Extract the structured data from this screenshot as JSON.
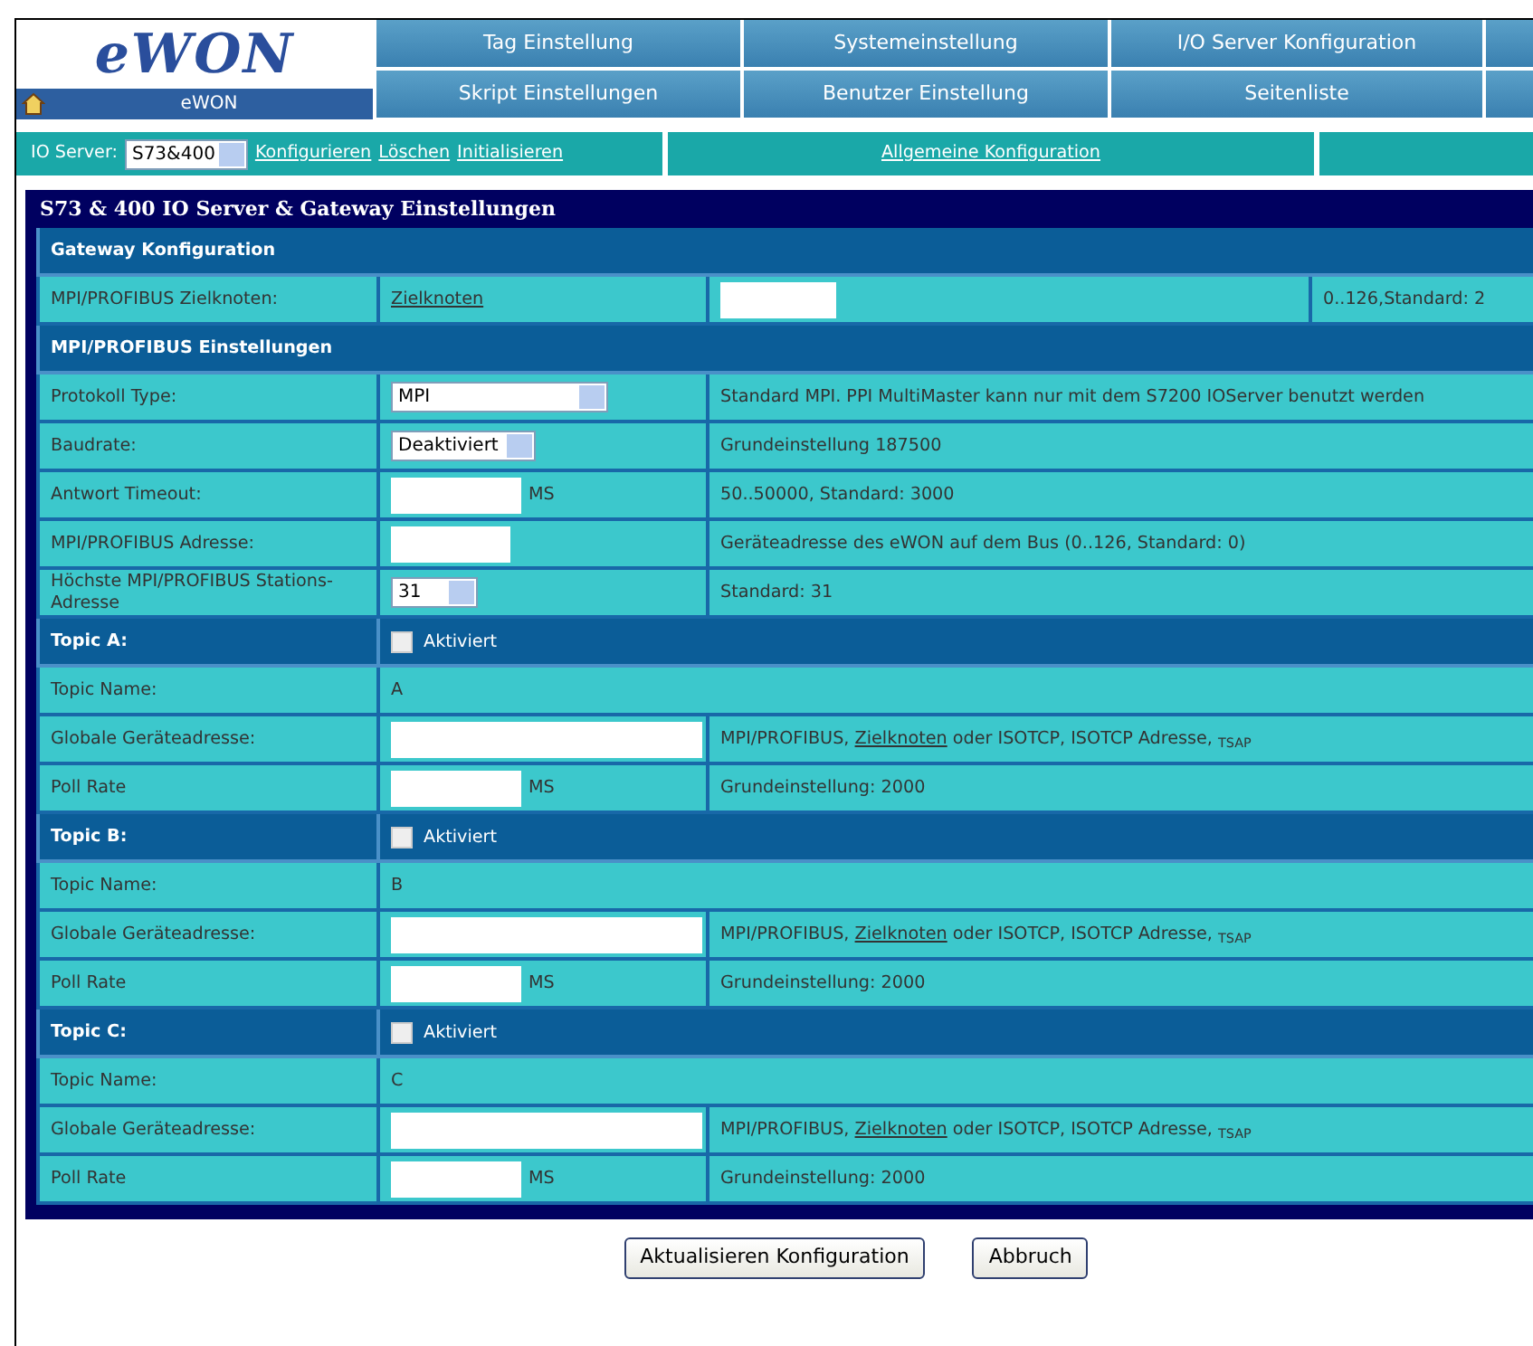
{
  "logo": {
    "text": "eWON",
    "caption": "eWON"
  },
  "nav": [
    {
      "label": "Tag Einstellung"
    },
    {
      "label": "Systemeinstellung"
    },
    {
      "label": "I/O Server Konfiguration"
    },
    {
      "label": "Skript Einstellungen"
    },
    {
      "label": "Benutzer Einstellung"
    },
    {
      "label": "Seitenliste"
    }
  ],
  "toolbar": {
    "label": "IO Server:",
    "server_select": "S73&400",
    "links": [
      "Konfigurieren",
      "Löschen",
      "Initialisieren"
    ],
    "general_link": "Allgemeine Konfiguration"
  },
  "panel": {
    "title": "S73 & 400 IO Server & Gateway Einstellungen",
    "sections": [
      {
        "title": "Gateway Konfiguration",
        "rows": [
          {
            "kind": "link_input",
            "label": "MPI/PROFIBUS Zielknoten:",
            "link": "Zielknoten",
            "hint": "0..126,Standard: 2"
          }
        ]
      },
      {
        "title": "MPI/PROFIBUS Einstellungen",
        "rows": [
          {
            "kind": "select",
            "label": "Protokoll Type:",
            "value": "MPI",
            "hint": "Standard MPI. PPI MultiMaster kann nur mit dem S7200 IOServer benutzt werden"
          },
          {
            "kind": "select",
            "label": "Baudrate:",
            "value": "Deaktiviert",
            "hint": "Grundeinstellung 187500"
          },
          {
            "kind": "input",
            "label": "Antwort Timeout:",
            "unit": "MS",
            "hint": "50..50000, Standard: 3000"
          },
          {
            "kind": "input",
            "label": "MPI/PROFIBUS Adresse:",
            "hint": "Geräteadresse des eWON auf dem Bus (0..126, Standard: 0)"
          },
          {
            "kind": "select",
            "label": "Höchste MPI/PROFIBUS Stations-Adresse",
            "value": "31",
            "hint": "Standard: 31"
          }
        ]
      },
      {
        "title": "Topic A:",
        "checkbox": {
          "label": "Aktiviert",
          "checked": false
        },
        "rows": [
          {
            "kind": "text",
            "label": "Topic Name:",
            "value": "A"
          },
          {
            "kind": "wide_input",
            "label": "Globale Geräteadresse:",
            "hint_parts": {
              "before": "MPI/PROFIBUS, ",
              "link": "Zielknoten",
              "after": " oder ISOTCP, ISOTCP Adresse, $_{TSAP}$"
            }
          },
          {
            "kind": "input",
            "label": "Poll Rate",
            "unit": "MS",
            "hint": "Grundeinstellung: 2000"
          }
        ]
      },
      {
        "title": "Topic B:",
        "checkbox": {
          "label": "Aktiviert",
          "checked": false
        },
        "rows": [
          {
            "kind": "text",
            "label": "Topic Name:",
            "value": "B"
          },
          {
            "kind": "wide_input",
            "label": "Globale Geräteadresse:",
            "hint_parts": {
              "before": "MPI/PROFIBUS, ",
              "link": "Zielknoten",
              "after": " oder ISOTCP, ISOTCP Adresse, $_{TSAP}$"
            }
          },
          {
            "kind": "input",
            "label": "Poll Rate",
            "unit": "MS",
            "hint": "Grundeinstellung: 2000"
          }
        ]
      },
      {
        "title": "Topic C:",
        "checkbox": {
          "label": "Aktiviert",
          "checked": false
        },
        "rows": [
          {
            "kind": "text",
            "label": "Topic Name:",
            "value": "C"
          },
          {
            "kind": "wide_input",
            "label": "Globale Geräteadresse:",
            "hint_parts": {
              "before": "MPI/PROFIBUS, ",
              "link": "Zielknoten",
              "after": " oder ISOTCP, ISOTCP Adresse, $_{TSAP}$"
            }
          },
          {
            "kind": "input",
            "label": "Poll Rate",
            "unit": "MS",
            "hint": "Grundeinstellung: 2000"
          }
        ]
      }
    ]
  },
  "buttons": [
    {
      "label": "Aktualisieren Konfiguration"
    },
    {
      "label": "Abbruch"
    }
  ]
}
